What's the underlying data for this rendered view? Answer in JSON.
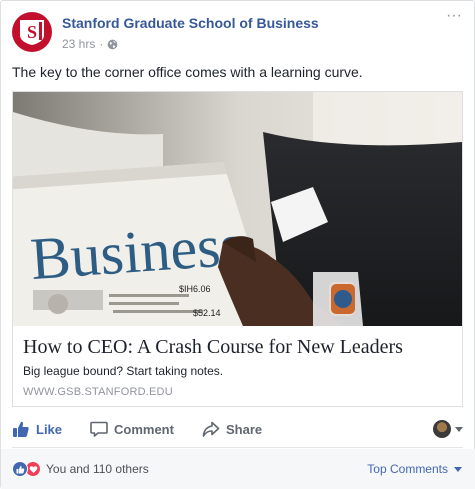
{
  "post": {
    "page_name": "Stanford Graduate School of Business",
    "timestamp": "23 hrs",
    "separator": "·",
    "privacy_icon": "globe-icon",
    "caption": "The key to the corner office comes with a learning curve."
  },
  "link": {
    "image_word": "Business",
    "image_figures": [
      "$IH6.06",
      "$52.14"
    ],
    "title": "How to CEO: A Crash Course for New Leaders",
    "description": "Big league bound? Start taking notes.",
    "domain": "WWW.GSB.STANFORD.EDU"
  },
  "actions": {
    "like": "Like",
    "comment": "Comment",
    "share": "Share"
  },
  "footer": {
    "reactions_text": "You and 110 others",
    "sort_label": "Top Comments"
  },
  "colors": {
    "brand_red": "#c2102c",
    "link_blue": "#365899",
    "like_blue": "#4267b2",
    "love_red": "#f33e58"
  }
}
